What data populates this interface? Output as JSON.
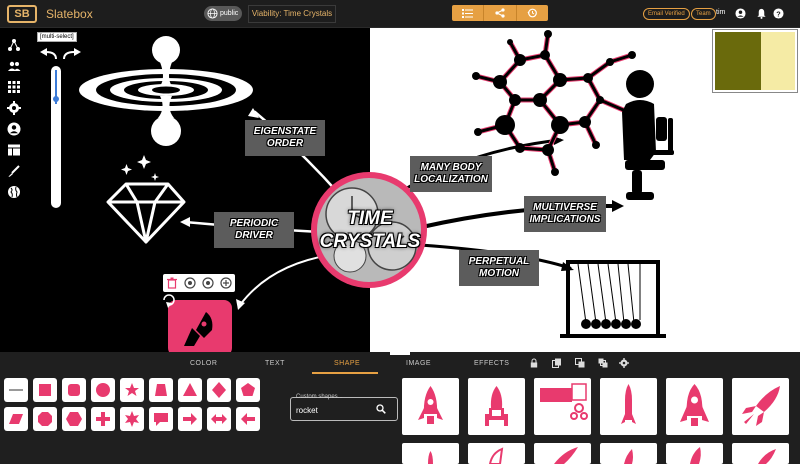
{
  "app": {
    "logo_text": "SB",
    "name": "Slatebox"
  },
  "header": {
    "visibility_badge": "public",
    "board_title": "Viability: Time Crystals",
    "email_status": "Email Verified",
    "team_label": "Team",
    "username": "tim"
  },
  "canvas": {
    "multiselect_label": "[multi-select]",
    "center_node": "TIME\nCRYSTALS",
    "nodes": [
      {
        "label": "EIGENSTATE\nORDER"
      },
      {
        "label": "PERIODIC\nDRIVER"
      },
      {
        "label": "MANY BODY\nLOCALIZATION"
      },
      {
        "label": "MULTIVERSE\nIMPLICATIONS"
      },
      {
        "label": "PERPETUAL\nMOTION"
      }
    ]
  },
  "panel": {
    "tabs": [
      "COLOR",
      "TEXT",
      "SHAPE",
      "IMAGE",
      "EFFECTS"
    ],
    "active_tab": "SHAPE",
    "search_label": "Custom shapes...",
    "search_value": "rocket"
  },
  "colors": {
    "accent": "#e6a043",
    "brand": "#e6b469",
    "pink": "#e83a6e",
    "panel_bg": "#1f1f1f"
  }
}
